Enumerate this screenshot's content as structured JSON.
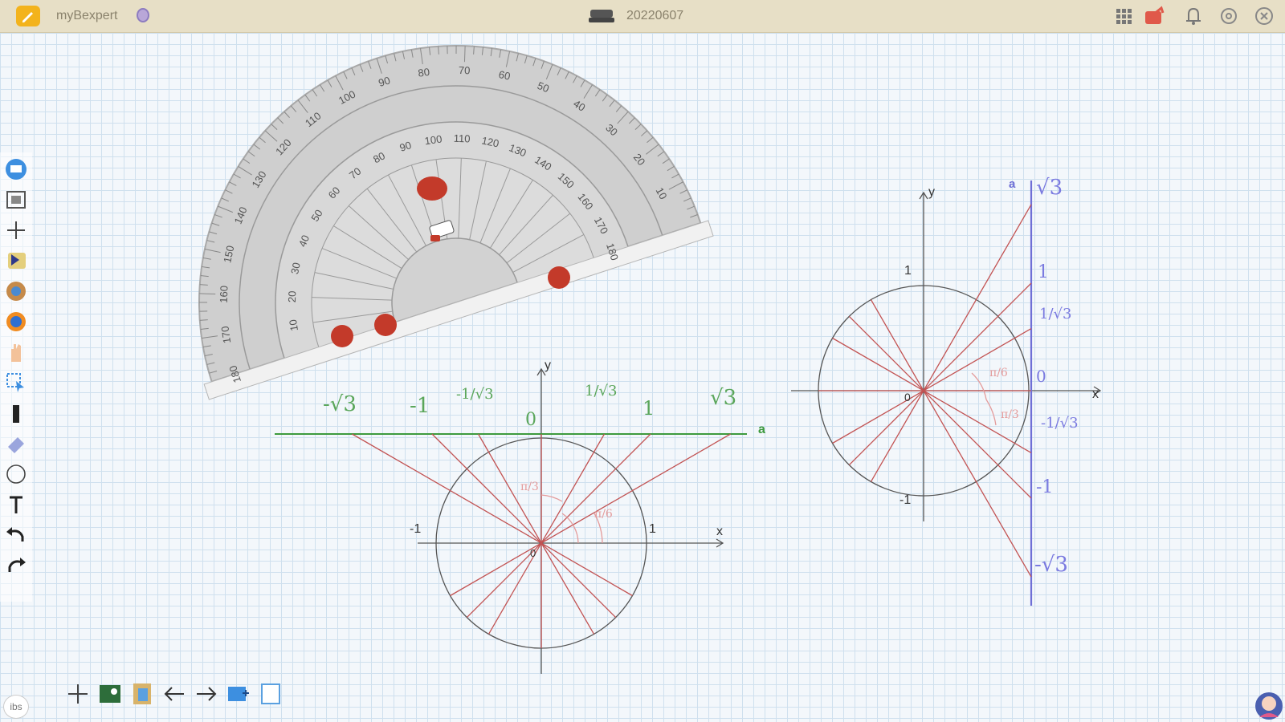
{
  "titlebar": {
    "app_name": "myBexpert",
    "date": "20220607",
    "icons": [
      "pencil-icon",
      "user-icon",
      "device-icon",
      "grid-icon",
      "share-icon",
      "bell-icon",
      "settings-icon",
      "close-icon"
    ]
  },
  "left_toolbar": {
    "tools": [
      "board-icon",
      "screenshot-icon",
      "move-icon",
      "cursor-icon",
      "globe-icon",
      "browser-icon",
      "hand-icon",
      "select-icon",
      "pen-icon",
      "eraser-icon",
      "circle-icon",
      "text-icon",
      "undo-icon",
      "redo-icon"
    ]
  },
  "bottom_toolbar": {
    "tools": [
      "move-icon",
      "image-icon",
      "clipboard-icon",
      "arrow-left-icon",
      "arrow-right-icon",
      "page-add-icon",
      "page-icon"
    ]
  },
  "corner": {
    "left_label": "ibs"
  },
  "protractor": {
    "outer_scale": [
      "10",
      "20",
      "30",
      "40",
      "50",
      "60",
      "70",
      "80",
      "90",
      "100",
      "110",
      "120",
      "130",
      "140",
      "150",
      "160",
      "170",
      "180"
    ],
    "inner_scale": [
      "10",
      "20",
      "30",
      "40",
      "50",
      "60",
      "70",
      "80",
      "90",
      "100",
      "110",
      "120",
      "130",
      "140",
      "150",
      "160",
      "170",
      "180"
    ],
    "color": "#d0d0d0"
  },
  "diagram_bottom": {
    "labels": {
      "y": "y",
      "x": "x",
      "a": "a",
      "minus_one": "-1",
      "one": "1",
      "origin": "0",
      "line_values": [
        "-√3",
        "-1",
        "-1/√3",
        "0",
        "1/√3",
        "1",
        "√3"
      ],
      "angles": [
        "π/6",
        "π/3"
      ]
    }
  },
  "diagram_right": {
    "labels": {
      "y": "y",
      "x": "x",
      "a": "a",
      "one": "1",
      "minus_one": "-1",
      "origin": "0",
      "line_values": [
        "√3",
        "1",
        "1/√3",
        "0",
        "-1/√3",
        "-1",
        "-√3"
      ],
      "angles": [
        "π/6",
        "π/3"
      ]
    }
  },
  "colors": {
    "red_lines": "#c25353",
    "green_line": "#3d9a3d",
    "blue_line": "#6f6fd6",
    "title_bg": "#e7dfc6",
    "grid": "#cfe0ee"
  }
}
